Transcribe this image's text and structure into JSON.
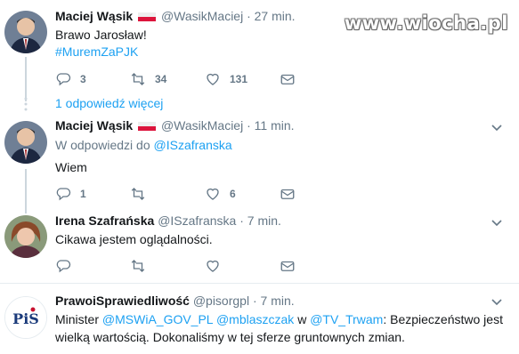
{
  "watermark": "www.wiocha.pl",
  "tweets": [
    {
      "name": "Maciej Wąsik",
      "handle": "@WasikMaciej",
      "time": "· 27 min.",
      "text": "Brawo Jarosław!",
      "hashtag": "#MuremZaPJK",
      "replies": "3",
      "retweets": "34",
      "likes": "131"
    },
    {
      "name": "Maciej Wąsik",
      "handle": "@WasikMaciej",
      "time": "· 11 min.",
      "reply_prefix": "W odpowiedzi do",
      "reply_to": "@ISzafranska",
      "text": "Wiem",
      "replies": "1",
      "retweets": "",
      "likes": "6"
    },
    {
      "name": "Irena Szafrańska",
      "handle": "@ISzafranska",
      "time": "· 7 min.",
      "text": "Cikawa jestem oglądalności."
    },
    {
      "name": "PrawoiSprawiedliwość",
      "handle": "@pisorgpl",
      "time": "· 7 min.",
      "text_parts": [
        "Minister ",
        "@MSWiA_GOV_PL",
        " ",
        "@mblaszczak",
        " w ",
        "@TV_Trwam",
        ": Bezpieczeństwo jest"
      ],
      "text_line2": "wielką wartością. Dokonaliśmy w tej sferze gruntownych zmian.",
      "avatar_text": "PiS"
    }
  ],
  "more_replies": "1 odpowiedź więcej",
  "colors": {
    "accent": "#1da1f2",
    "muted": "#657786",
    "text": "#14171a"
  }
}
